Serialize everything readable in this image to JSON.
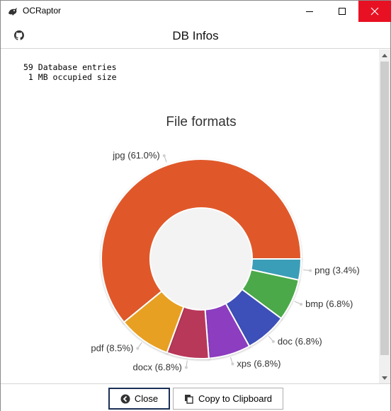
{
  "window": {
    "title": "OCRaptor"
  },
  "header": {
    "title": "DB Infos",
    "left_icon": "github-icon"
  },
  "stats": {
    "entries_line": "59 Database entries",
    "size_line": " 1 MB occupied size"
  },
  "chart_data": {
    "type": "pie",
    "title": "File formats",
    "donut": true,
    "categories": [
      "jpg",
      "png",
      "bmp",
      "doc",
      "xps",
      "docx",
      "pdf"
    ],
    "values": [
      61.0,
      3.4,
      6.8,
      6.8,
      6.8,
      6.8,
      8.5
    ],
    "labels": [
      "jpg (61.0%)",
      "png (3.4%)",
      "bmp (6.8%)",
      "doc (6.8%)",
      "xps (6.8%)",
      "docx (6.8%)",
      "pdf (8.5%)"
    ],
    "colors": [
      "#e0582c",
      "#3a9eb8",
      "#4ca94a",
      "#3d4fb8",
      "#8c3cc0",
      "#b8385a",
      "#e8a020"
    ]
  },
  "footer": {
    "close_label": "Close",
    "copy_label": "Copy to Clipboard"
  }
}
